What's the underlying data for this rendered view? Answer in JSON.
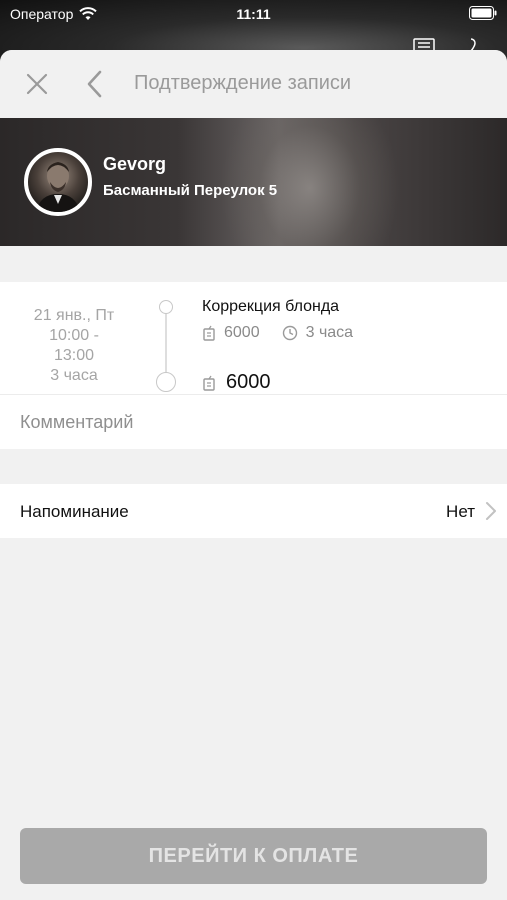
{
  "status_bar": {
    "carrier": "Оператор",
    "time": "11:11"
  },
  "nav": {
    "title": "Подтверждение записи",
    "close_icon": "close-icon",
    "back_icon": "chevron-left-icon"
  },
  "master": {
    "name": "Gevorg",
    "address": "Басманный Переулок 5"
  },
  "booking": {
    "date": "21 янв., Пт",
    "time_start": "10:00 -",
    "time_end": "13:00",
    "duration": "3 часа",
    "service_name": "Коррекция блонда",
    "service_price": "6000",
    "service_duration": "3 часа",
    "total": "6000"
  },
  "comment": {
    "placeholder": "Комментарий"
  },
  "reminder": {
    "label": "Напоминание",
    "value": "Нет"
  },
  "pay_button": {
    "label": "ПЕРЕЙТИ К ОПЛАТЕ"
  },
  "colors": {
    "sheet_bg": "#f1f1f1",
    "button_bg": "#a9a9a9",
    "muted_text": "#9a9a9a"
  }
}
